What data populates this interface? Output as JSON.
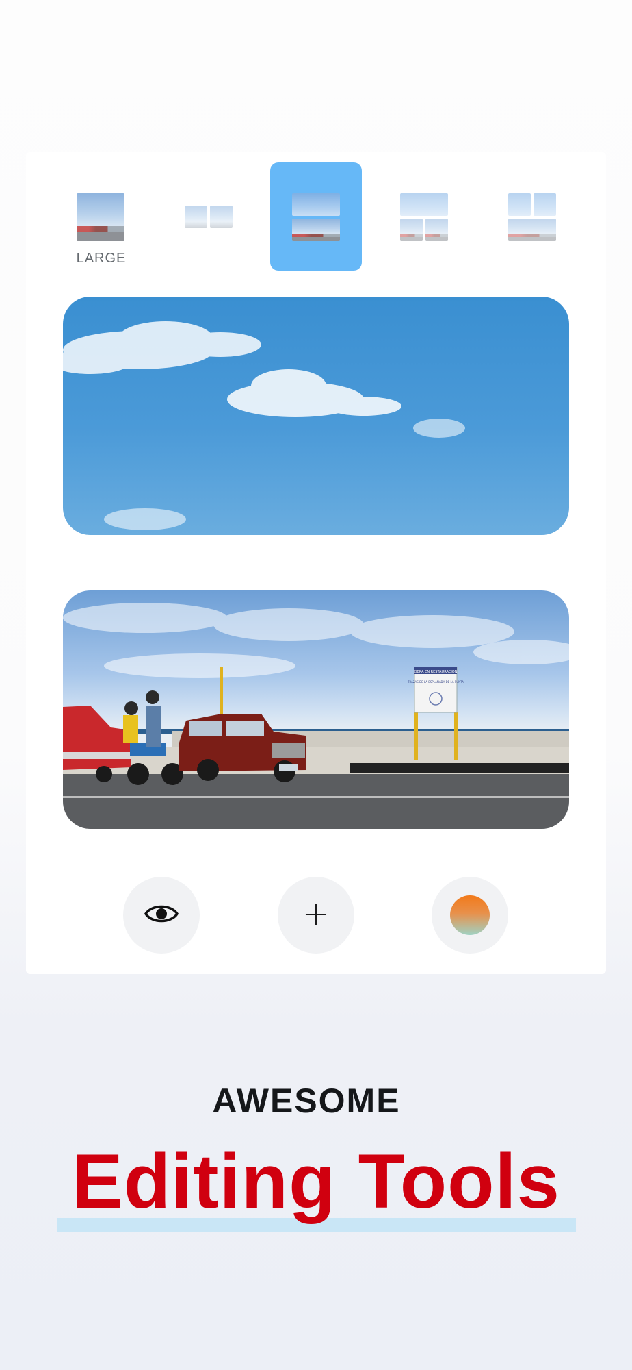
{
  "layout_selector": {
    "selected_index": 2,
    "options": [
      {
        "id": "large",
        "label": "LARGE"
      },
      {
        "id": "two-side-by-side",
        "label": ""
      },
      {
        "id": "two-stacked",
        "label": ""
      },
      {
        "id": "one-top-two-bottom",
        "label": ""
      },
      {
        "id": "grid-four",
        "label": ""
      }
    ]
  },
  "photos": [
    {
      "id": "sky",
      "description_icon": "photo-sky"
    },
    {
      "id": "street",
      "sign_title": "OBRA EN RESTAURACION",
      "sign_text": "TRAZAS DE LA ESPLANADA DE LA PUNTA"
    }
  ],
  "actions": {
    "preview_icon": "eye-icon",
    "add_icon": "plus-icon",
    "add_symbol": "+",
    "color_icon": "color-swatch-icon",
    "color_gradient": [
      "#f27a1a",
      "#9fd2c3"
    ]
  },
  "promo": {
    "eyebrow": "AWESOME",
    "headline": "Editing Tools",
    "headline_color": "#d0000f",
    "accent_color": "#66b8f7"
  }
}
